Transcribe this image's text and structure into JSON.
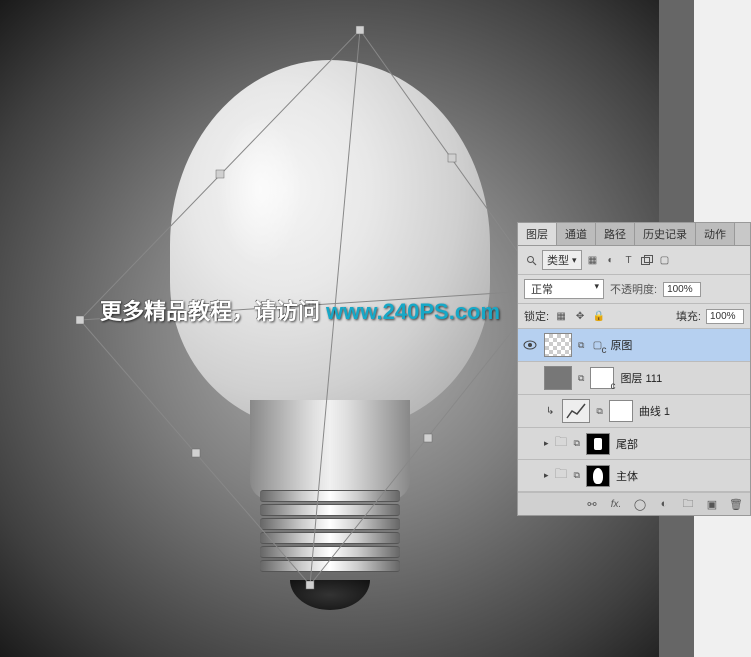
{
  "watermark": {
    "text": "更多精品教程，请访问",
    "url": "www.240PS.com"
  },
  "panel": {
    "tabs": {
      "layers": "图层",
      "channels": "通道",
      "paths": "路径",
      "history": "历史记录",
      "actions": "动作"
    },
    "filter": {
      "kind": "类型",
      "kind_symbol": "ρ"
    },
    "blend": {
      "mode": "正常",
      "opacity_label": "不透明度:",
      "opacity_value": "100%"
    },
    "lock": {
      "label": "锁定:",
      "fill_label": "填充:",
      "fill_value": "100%"
    },
    "layers": {
      "l0": "原图",
      "l1": "图层 111",
      "l2": "曲线 1",
      "l3": "尾部",
      "l4": "主体"
    },
    "icons": {
      "image": "▦",
      "adjust": "◐",
      "text": "T",
      "shape": "▭",
      "smart": "▢",
      "eye": "👁",
      "link": "⧉",
      "curves": "↯",
      "folder": "🗀",
      "toggle": "▸",
      "clip": "↳",
      "fx": "fx.",
      "mask": "◯",
      "newfolder": "🗀",
      "newlayer": "▣",
      "trash": "🗑",
      "chain": "⚯",
      "csub": "c"
    }
  }
}
